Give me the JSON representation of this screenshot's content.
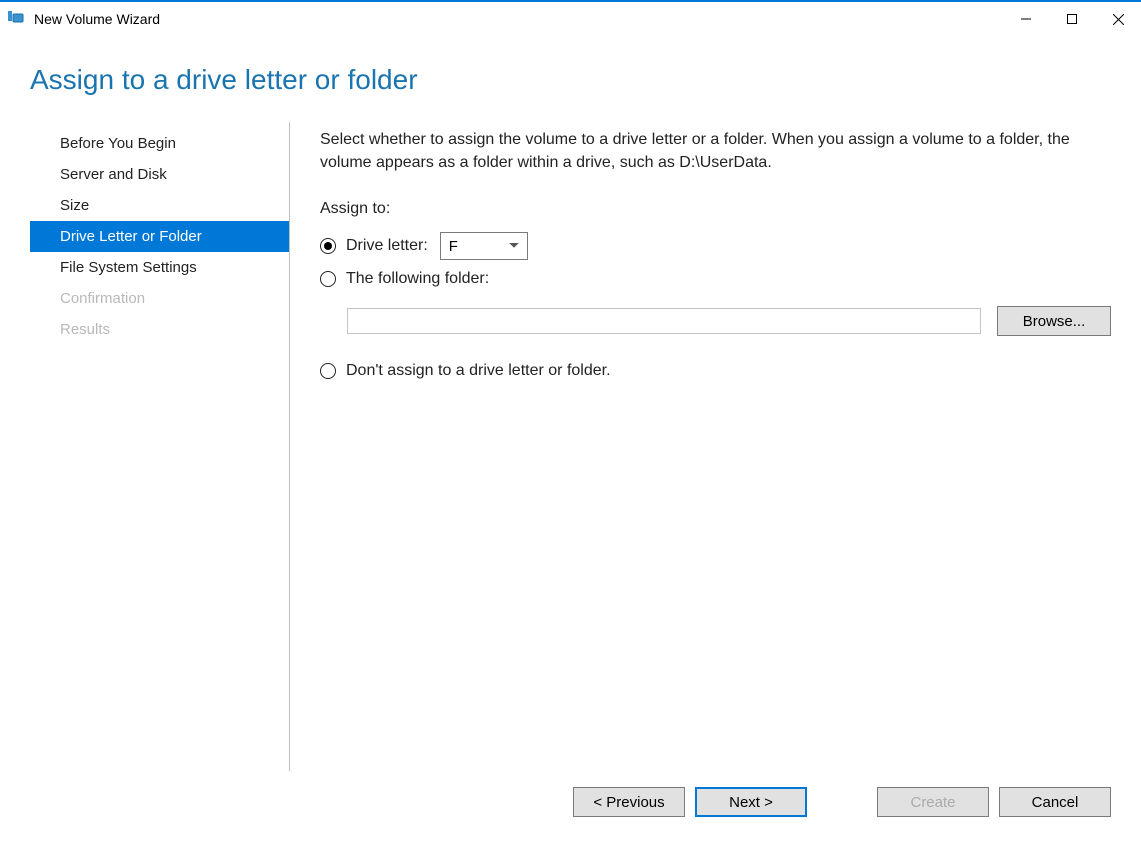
{
  "window": {
    "title": "New Volume Wizard"
  },
  "page": {
    "heading": "Assign to a drive letter or folder"
  },
  "sidebar": {
    "items": [
      {
        "label": "Before You Begin",
        "state": "normal"
      },
      {
        "label": "Server and Disk",
        "state": "normal"
      },
      {
        "label": "Size",
        "state": "normal"
      },
      {
        "label": "Drive Letter or Folder",
        "state": "active"
      },
      {
        "label": "File System Settings",
        "state": "normal"
      },
      {
        "label": "Confirmation",
        "state": "disabled"
      },
      {
        "label": "Results",
        "state": "disabled"
      }
    ]
  },
  "main": {
    "instructions": "Select whether to assign the volume to a drive letter or a folder. When you assign a volume to a folder, the volume appears as a folder within a drive, such as D:\\UserData.",
    "assign_to_label": "Assign to:",
    "options": {
      "drive_letter": {
        "label": "Drive letter:",
        "value": "F",
        "selected": true
      },
      "folder": {
        "label": "The following folder:",
        "path": "",
        "browse_label": "Browse...",
        "selected": false
      },
      "none": {
        "label": "Don't assign to a drive letter or folder.",
        "selected": false
      }
    }
  },
  "footer": {
    "previous": "< Previous",
    "next": "Next >",
    "create": "Create",
    "cancel": "Cancel"
  }
}
